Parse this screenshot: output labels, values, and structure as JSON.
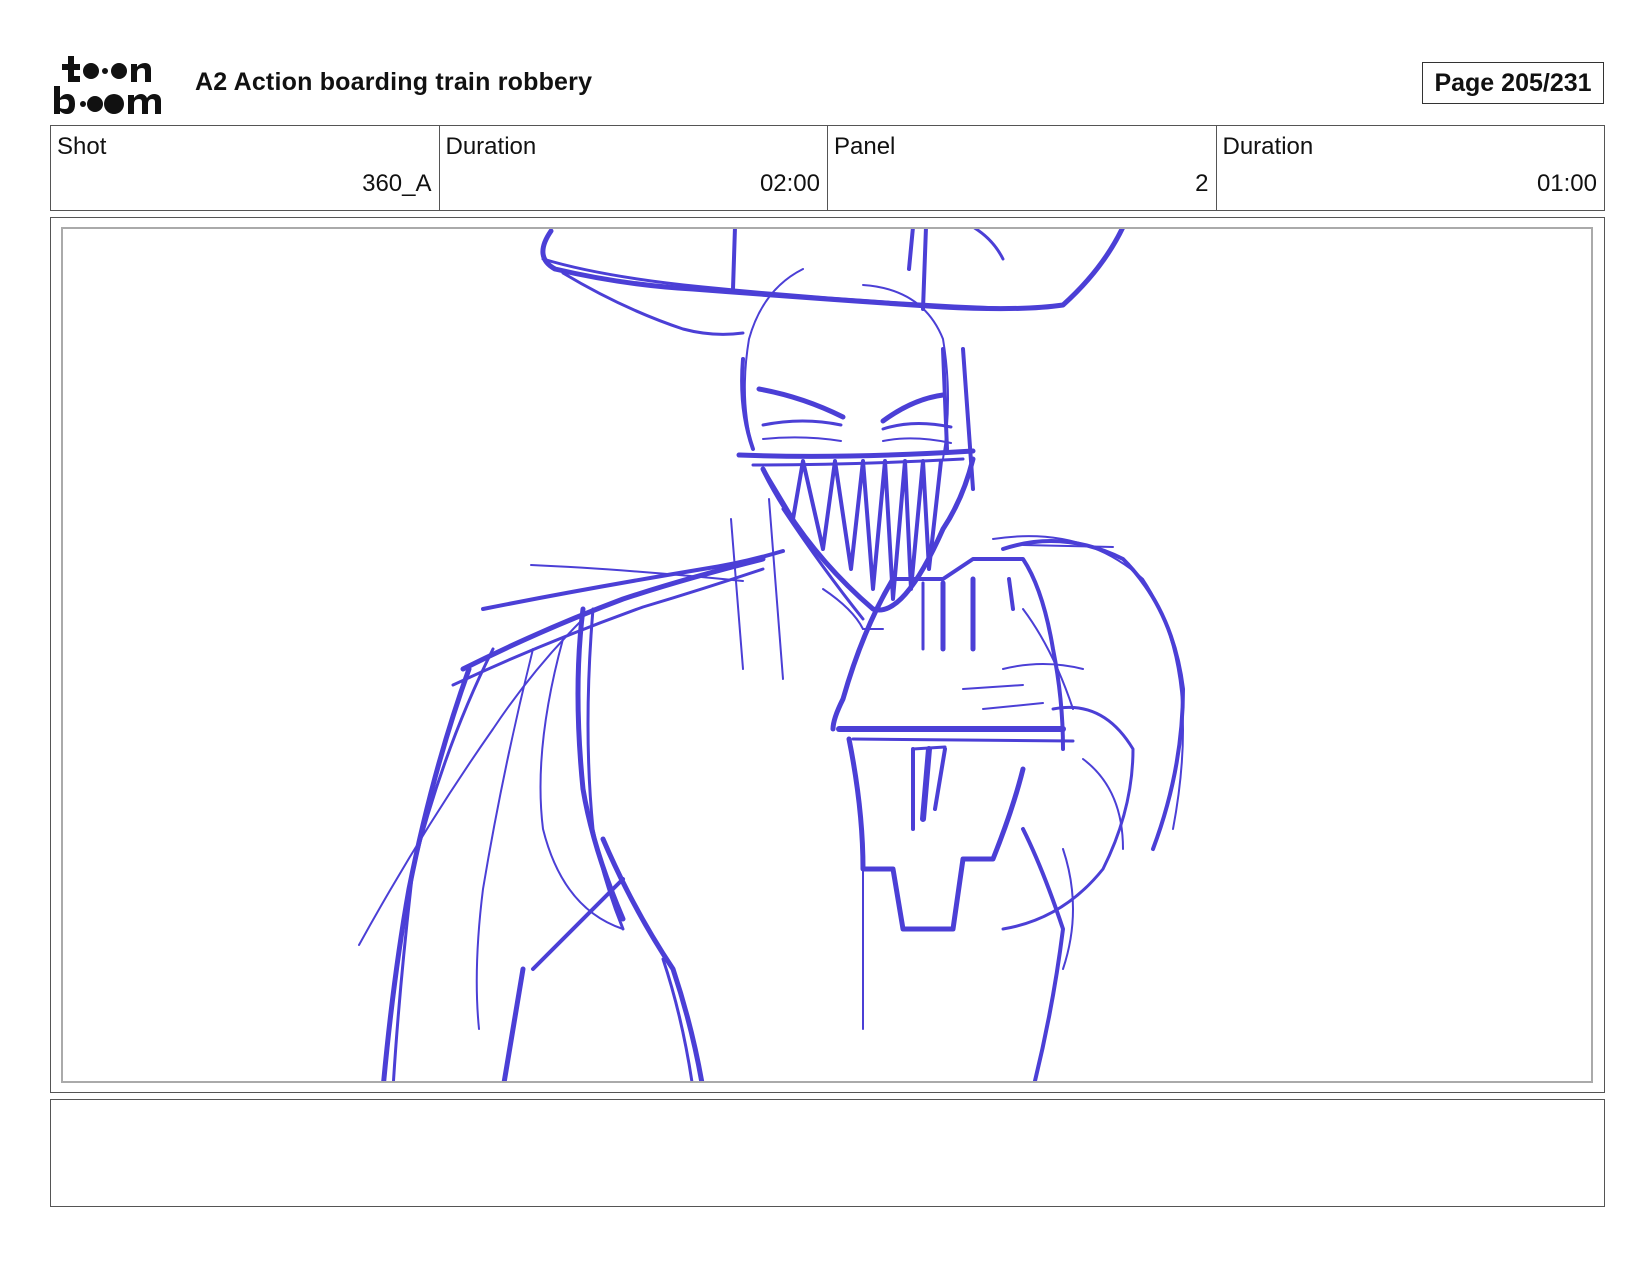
{
  "header": {
    "logo_text": "toon boom",
    "title": "A2 Action boarding train robbery",
    "page_label": "Page",
    "page_number": "205/231"
  },
  "info": [
    {
      "label": "Shot",
      "value": "360_A"
    },
    {
      "label": "Duration",
      "value": "02:00"
    },
    {
      "label": "Panel",
      "value": "2"
    },
    {
      "label": "Duration",
      "value": "01:00"
    }
  ],
  "panel": {
    "sketch_color": "#4b3fd6"
  },
  "caption": {
    "text": ""
  }
}
